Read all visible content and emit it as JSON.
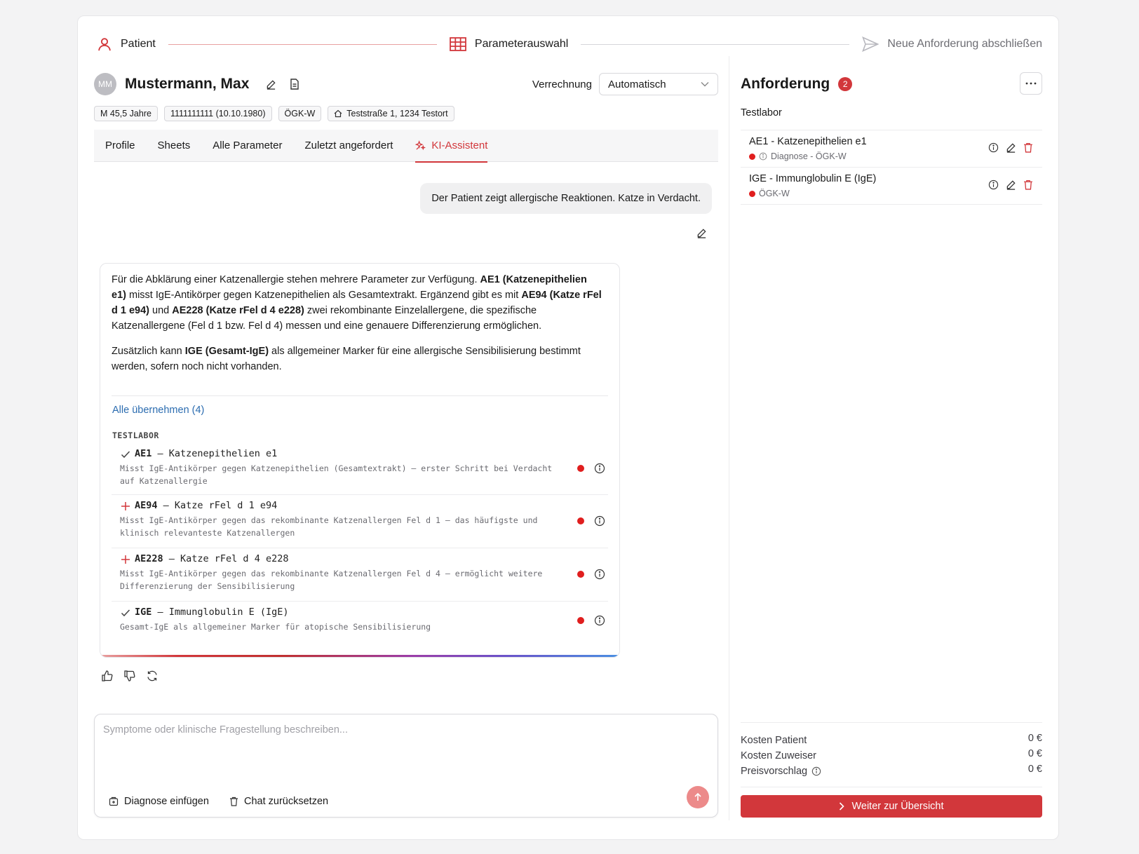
{
  "stepper": {
    "steps": [
      {
        "label": "Patient",
        "icon": "user-icon",
        "state": "done"
      },
      {
        "label": "Parameterauswahl",
        "icon": "table-icon",
        "state": "active"
      },
      {
        "label": "Neue Anforderung abschließen",
        "icon": "send-icon",
        "state": "inactive"
      }
    ]
  },
  "patient": {
    "initials": "MM",
    "name": "Mustermann, Max",
    "chips": [
      "M 45,5 Jahre",
      "1111111111 (10.10.1980)",
      "ÖGK-W",
      "Teststraße 1, 1234 Testort"
    ]
  },
  "billing": {
    "label": "Verrechnung",
    "value": "Automatisch"
  },
  "tabs": [
    "Profile",
    "Sheets",
    "Alle Parameter",
    "Zuletzt angefordert",
    "KI-Assistent"
  ],
  "active_tab": "KI-Assistent",
  "chat": {
    "user_message": "Der Patient zeigt allergische Reaktionen. Katze in Verdacht.",
    "answer_p1_a": "Für die Abklärung einer Katzenallergie stehen mehrere Parameter zur Verfügung. ",
    "answer_p1_b": "AE1 (Katzenepithelien e1)",
    "answer_p1_c": " misst IgE-Antikörper gegen Katzenepithelien als Gesamtextrakt. Ergänzend gibt es mit ",
    "answer_p1_d": "AE94 (Katze rFel d 1 e94)",
    "answer_p1_e": " und ",
    "answer_p1_f": "AE228 (Katze rFel d 4 e228)",
    "answer_p1_g": " zwei rekombinante Einzelallergene, die spezifische Katzenallergene (Fel d 1 bzw. Fel d 4) messen und eine genauere Differenzierung ermöglichen.",
    "answer_p2_a": "Zusätzlich kann ",
    "answer_p2_b": "IGE (Gesamt-IgE)",
    "answer_p2_c": " als allgemeiner Marker für eine allergische Sensibilisierung bestimmt werden, sofern noch nicht vorhanden.",
    "take_all": "Alle übernehmen (4)",
    "lab_heading": "TESTLABOR",
    "suggestions": [
      {
        "code": "AE1",
        "sep": " — ",
        "name": "Katzenepithelien e1",
        "desc": "Misst IgE-Antikörper gegen Katzenepithelien (Gesamtextrakt) — erster Schritt bei Verdacht auf Katzenallergie",
        "added": true
      },
      {
        "code": "AE94",
        "sep": " — ",
        "name": "Katze rFel d 1 e94",
        "desc": "Misst IgE-Antikörper gegen das rekombinante Katzenallergen Fel d 1 — das häufigste und klinisch relevanteste Katzenallergen",
        "added": false
      },
      {
        "code": "AE228",
        "sep": " — ",
        "name": "Katze rFel d 4 e228",
        "desc": "Misst IgE-Antikörper gegen das rekombinante Katzenallergen Fel d 4 — ermöglicht weitere Differenzierung der Sensibilisierung",
        "added": false
      },
      {
        "code": "IGE",
        "sep": " — ",
        "name": "Immunglobulin E (IgE)",
        "desc": "Gesamt-IgE als allgemeiner Marker für atopische Sensibilisierung",
        "added": true
      }
    ]
  },
  "composer": {
    "placeholder": "Symptome oder klinische Fragestellung beschreiben...",
    "value": "",
    "insert_diagnosis": "Diagnose einfügen",
    "reset_chat": "Chat zurücksetzen"
  },
  "request": {
    "title": "Anforderung",
    "count": "2",
    "lab": "Testlabor",
    "items": [
      {
        "title": "AE1 - Katzenepithelien e1",
        "sub": "Diagnose - ÖGK-W",
        "has_info": true
      },
      {
        "title": "IGE - Immunglobulin E (IgE)",
        "sub": "ÖGK-W",
        "has_info": false
      }
    ]
  },
  "costs": {
    "patient_label": "Kosten Patient",
    "patient_value": "0 €",
    "referrer_label": "Kosten Zuweiser",
    "referrer_value": "0 €",
    "proposal_label": "Preisvorschlag",
    "proposal_value": "0 €"
  },
  "next_button": "Weiter zur Übersicht",
  "colors": {
    "accent": "#d2373b",
    "link": "#2b6cb0",
    "status_dot": "#e01e1e"
  }
}
